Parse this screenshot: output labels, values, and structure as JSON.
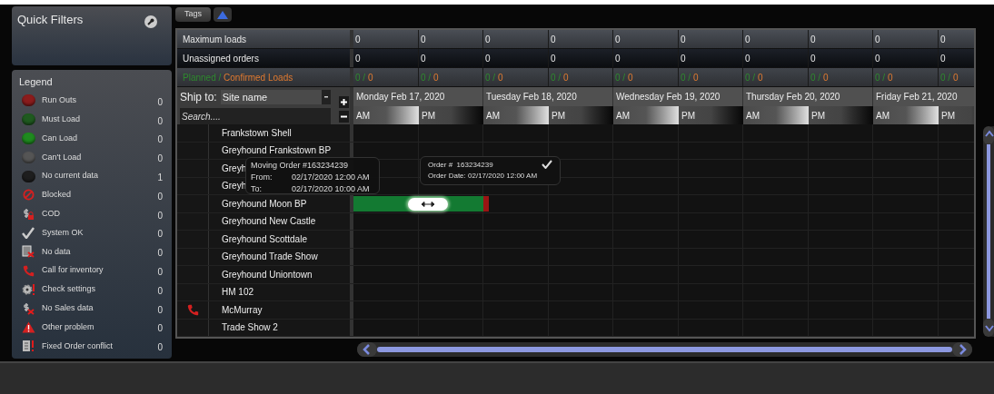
{
  "quick_filters": {
    "title": "Quick Filters"
  },
  "legend": {
    "title": "Legend",
    "items": [
      {
        "kind": "dot",
        "color": "#8b1c1c",
        "label": "Run Outs",
        "count": "0"
      },
      {
        "kind": "dot",
        "color": "#1f5a1f",
        "label": "Must Load",
        "count": "0"
      },
      {
        "kind": "dot",
        "color": "#1f8a1f",
        "label": "Can Load",
        "count": "0"
      },
      {
        "kind": "dot",
        "color": "#555555",
        "label": "Can't Load",
        "count": "0"
      },
      {
        "kind": "dot",
        "color": "#1e1e1e",
        "label": "No current data",
        "count": "1"
      },
      {
        "kind": "blocked",
        "label": "Blocked",
        "count": "0"
      },
      {
        "kind": "cod",
        "label": "COD",
        "count": "0"
      },
      {
        "kind": "check",
        "label": "System OK",
        "count": "0"
      },
      {
        "kind": "no-data",
        "label": "No data",
        "count": "0"
      },
      {
        "kind": "phone",
        "label": "Call for inventory",
        "count": "0"
      },
      {
        "kind": "gear-alert",
        "label": "Check settings",
        "count": "0"
      },
      {
        "kind": "no-sales",
        "label": "No Sales data",
        "count": "0"
      },
      {
        "kind": "warning",
        "label": "Other problem",
        "count": "0"
      },
      {
        "kind": "doc-alert",
        "label": "Fixed Order conflict",
        "count": "0"
      }
    ]
  },
  "toolbar": {
    "tags_button": "Tags"
  },
  "summary_rows": [
    {
      "kind": "light",
      "label": "Maximum loads",
      "values": [
        "0",
        "0",
        "0",
        "0",
        "0",
        "0",
        "0",
        "0",
        "0",
        "0"
      ]
    },
    {
      "kind": "dark",
      "label": "Unassigned orders",
      "values": [
        "0",
        "0",
        "0",
        "0",
        "0",
        "0",
        "0",
        "0",
        "0",
        "0"
      ]
    },
    {
      "kind": "split",
      "planned_label": "Planned /",
      "confirmed_label": "Confirmed Loads",
      "values": [
        {
          "planned": "0 /",
          "confirmed": "0"
        },
        {
          "planned": "0 /",
          "confirmed": "0"
        },
        {
          "planned": "0 /",
          "confirmed": "0"
        },
        {
          "planned": "0 /",
          "confirmed": "0"
        },
        {
          "planned": "0 /",
          "confirmed": "0"
        },
        {
          "planned": "0 /",
          "confirmed": "0"
        },
        {
          "planned": "0 /",
          "confirmed": "0"
        },
        {
          "planned": "0 /",
          "confirmed": "0"
        },
        {
          "planned": "0 /",
          "confirmed": "0"
        },
        {
          "planned": "0 /",
          "confirmed": "0"
        }
      ]
    }
  ],
  "ship_to": {
    "label": "Ship to:",
    "dropdown": "Site name",
    "search_placeholder": "Search...."
  },
  "days": [
    {
      "label": "Monday Feb 17, 2020",
      "halves": [
        "AM",
        "PM"
      ]
    },
    {
      "label": "Tuesday Feb 18, 2020",
      "halves": [
        "AM",
        "PM"
      ]
    },
    {
      "label": "Wednesday Feb 19, 2020",
      "halves": [
        "AM",
        "PM"
      ]
    },
    {
      "label": "Thursday Feb 20, 2020",
      "halves": [
        "AM",
        "PM"
      ]
    },
    {
      "label": "Friday Feb 21, 2020",
      "halves": [
        "AM",
        "PM"
      ]
    }
  ],
  "sites": [
    {
      "name": "Frankstown Shell"
    },
    {
      "name": "Greyhound Frankstown BP"
    },
    {
      "name": "Greyh"
    },
    {
      "name": "Greyh"
    },
    {
      "name": "Greyhound Moon BP",
      "order": true
    },
    {
      "name": "Greyhound New Castle"
    },
    {
      "name": "Greyhound Scottdale"
    },
    {
      "name": "Greyhound Trade Show"
    },
    {
      "name": "Greyhound Uniontown"
    },
    {
      "name": "HM 102"
    },
    {
      "name": "McMurray",
      "call_alert": true
    },
    {
      "name": "Trade Show 2"
    }
  ],
  "move_tooltip": {
    "title": "Moving Order #163234239",
    "rows": [
      {
        "label": "From:",
        "value": "02/17/2020 12:00 AM"
      },
      {
        "label": "To:",
        "value": "02/17/2020 10:00 AM"
      }
    ]
  },
  "order_tooltip": {
    "order_label": "Order #",
    "order_number": "163234239",
    "date_label": "Order Date:",
    "date": "02/17/2020 12:00 AM",
    "confirmed": true
  }
}
